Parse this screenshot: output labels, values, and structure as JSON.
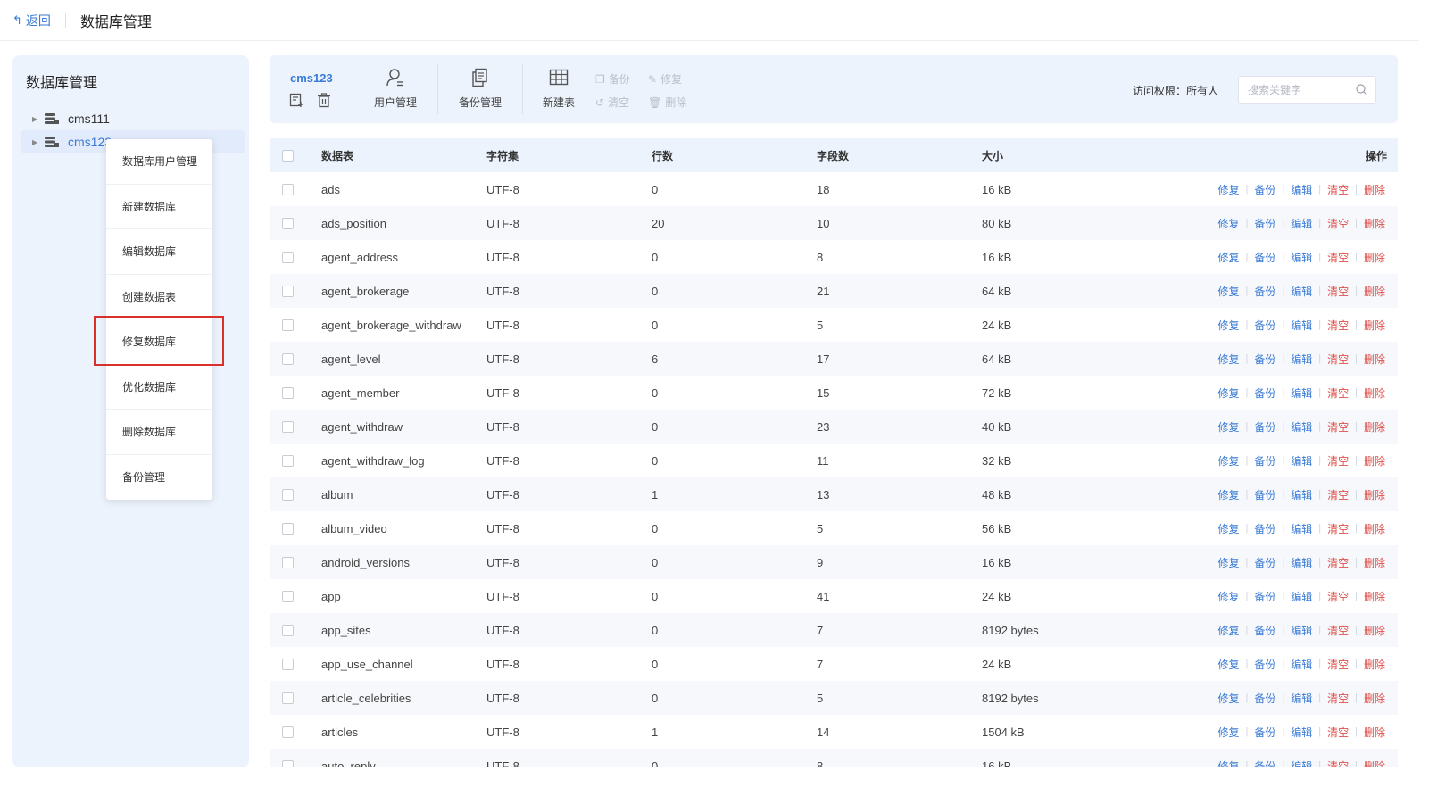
{
  "topbar": {
    "back_label": "返回",
    "title": "数据库管理"
  },
  "sidebar": {
    "title": "数据库管理",
    "databases": [
      {
        "name": "cms111",
        "active": false
      },
      {
        "name": "cms123",
        "active": true
      }
    ]
  },
  "context_menu": {
    "items": [
      "数据库用户管理",
      "新建数据库",
      "编辑数据库",
      "创建数据表",
      "修复数据库",
      "优化数据库",
      "删除数据库",
      "备份管理"
    ],
    "highlighted": "修复数据库"
  },
  "toolbar": {
    "db_name": "cms123",
    "user_mgmt": "用户管理",
    "backup_mgmt": "备份管理",
    "new_table": "新建表",
    "backup": "备份",
    "repair": "修复",
    "clear": "清空",
    "delete": "删除",
    "access_label": "访问权限：所有人",
    "search_placeholder": "搜索关键字"
  },
  "table": {
    "headers": {
      "name": "数据表",
      "charset": "字符集",
      "rows": "行数",
      "fields": "字段数",
      "size": "大小",
      "ops": "操作"
    },
    "ops": [
      "修复",
      "备份",
      "编辑",
      "清空",
      "删除"
    ],
    "rows": [
      {
        "name": "ads",
        "charset": "UTF-8",
        "rows": "0",
        "fields": "18",
        "size": "16 kB"
      },
      {
        "name": "ads_position",
        "charset": "UTF-8",
        "rows": "20",
        "fields": "10",
        "size": "80 kB"
      },
      {
        "name": "agent_address",
        "charset": "UTF-8",
        "rows": "0",
        "fields": "8",
        "size": "16 kB"
      },
      {
        "name": "agent_brokerage",
        "charset": "UTF-8",
        "rows": "0",
        "fields": "21",
        "size": "64 kB"
      },
      {
        "name": "agent_brokerage_withdraw",
        "charset": "UTF-8",
        "rows": "0",
        "fields": "5",
        "size": "24 kB"
      },
      {
        "name": "agent_level",
        "charset": "UTF-8",
        "rows": "6",
        "fields": "17",
        "size": "64 kB"
      },
      {
        "name": "agent_member",
        "charset": "UTF-8",
        "rows": "0",
        "fields": "15",
        "size": "72 kB"
      },
      {
        "name": "agent_withdraw",
        "charset": "UTF-8",
        "rows": "0",
        "fields": "23",
        "size": "40 kB"
      },
      {
        "name": "agent_withdraw_log",
        "charset": "UTF-8",
        "rows": "0",
        "fields": "11",
        "size": "32 kB"
      },
      {
        "name": "album",
        "charset": "UTF-8",
        "rows": "1",
        "fields": "13",
        "size": "48 kB"
      },
      {
        "name": "album_video",
        "charset": "UTF-8",
        "rows": "0",
        "fields": "5",
        "size": "56 kB"
      },
      {
        "name": "android_versions",
        "charset": "UTF-8",
        "rows": "0",
        "fields": "9",
        "size": "16 kB"
      },
      {
        "name": "app",
        "charset": "UTF-8",
        "rows": "0",
        "fields": "41",
        "size": "24 kB"
      },
      {
        "name": "app_sites",
        "charset": "UTF-8",
        "rows": "0",
        "fields": "7",
        "size": "8192 bytes"
      },
      {
        "name": "app_use_channel",
        "charset": "UTF-8",
        "rows": "0",
        "fields": "7",
        "size": "24 kB"
      },
      {
        "name": "article_celebrities",
        "charset": "UTF-8",
        "rows": "0",
        "fields": "5",
        "size": "8192 bytes"
      },
      {
        "name": "articles",
        "charset": "UTF-8",
        "rows": "1",
        "fields": "14",
        "size": "1504 kB"
      },
      {
        "name": "auto_reply",
        "charset": "UTF-8",
        "rows": "0",
        "fields": "8",
        "size": "16 kB"
      }
    ]
  },
  "colors": {
    "accent": "#3a7bd5",
    "danger": "#e0504b",
    "panel": "#edf3fd",
    "highlight_border": "#d9302b"
  }
}
